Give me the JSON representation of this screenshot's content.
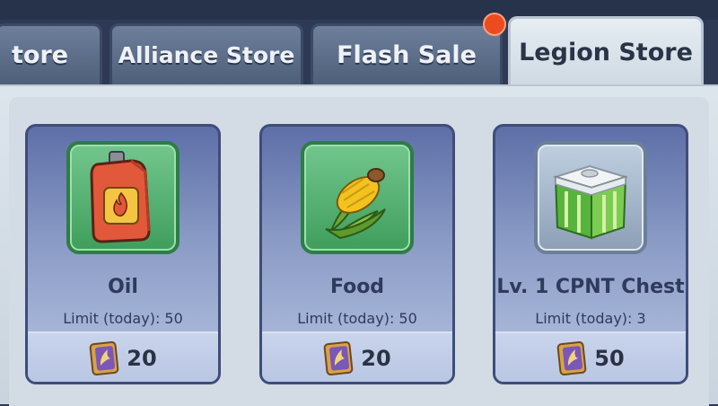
{
  "tabs": [
    {
      "label": "tore",
      "active": false
    },
    {
      "label": "Alliance Store",
      "active": false
    },
    {
      "label": "Flash Sale",
      "active": false,
      "notification": true
    },
    {
      "label": "Legion Store",
      "active": true
    }
  ],
  "items": [
    {
      "name": "Oil",
      "limit": "Limit (today): 50",
      "price": "20",
      "icon": "oil-can-icon"
    },
    {
      "name": "Food",
      "limit": "Limit (today): 50",
      "price": "20",
      "icon": "corn-icon"
    },
    {
      "name": "Lv. 1 CPNT Chest",
      "limit": "Limit (today): 3",
      "price": "50",
      "icon": "chest-icon"
    }
  ],
  "currency_icon": "legion-token-icon",
  "colors": {
    "tab_active": "#e6edf3",
    "tab_inactive": "#5f7190",
    "card": "#7b8dc0",
    "notification_dot": "#ec4b1f",
    "icon_frame_green": "#4fae6c"
  }
}
